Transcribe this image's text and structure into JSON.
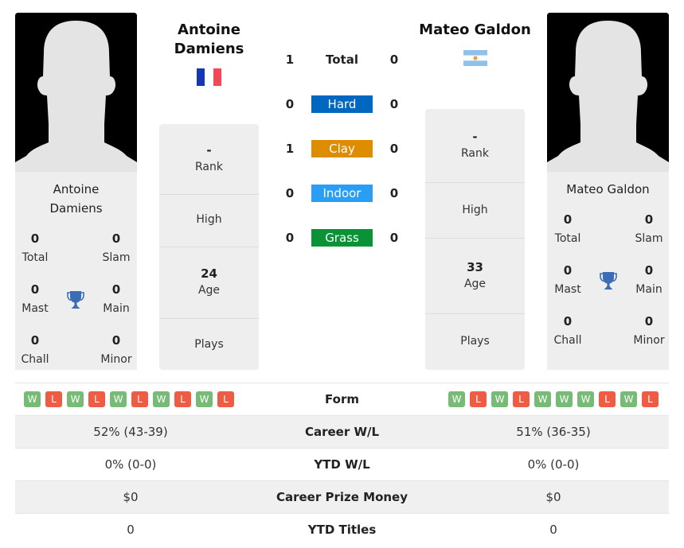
{
  "player_left": {
    "name": "Antoine Damiens",
    "card_name_line1": "Antoine",
    "card_name_line2": "Damiens",
    "flag": "france-flag",
    "titles": {
      "total": {
        "value": "0",
        "label": "Total"
      },
      "slam": {
        "value": "0",
        "label": "Slam"
      },
      "mast": {
        "value": "0",
        "label": "Mast"
      },
      "main": {
        "value": "0",
        "label": "Main"
      },
      "chall": {
        "value": "0",
        "label": "Chall"
      },
      "minor": {
        "value": "0",
        "label": "Minor"
      }
    },
    "info": {
      "rank": {
        "value": "-",
        "label": "Rank"
      },
      "high": {
        "value": "",
        "label": "High"
      },
      "age": {
        "value": "24",
        "label": "Age"
      },
      "plays": {
        "value": "",
        "label": "Plays"
      }
    },
    "form": [
      "W",
      "L",
      "W",
      "L",
      "W",
      "L",
      "W",
      "L",
      "W",
      "L"
    ]
  },
  "player_right": {
    "name": "Mateo Galdon",
    "card_name": "Mateo Galdon",
    "flag": "argentina-flag",
    "titles": {
      "total": {
        "value": "0",
        "label": "Total"
      },
      "slam": {
        "value": "0",
        "label": "Slam"
      },
      "mast": {
        "value": "0",
        "label": "Mast"
      },
      "main": {
        "value": "0",
        "label": "Main"
      },
      "chall": {
        "value": "0",
        "label": "Chall"
      },
      "minor": {
        "value": "0",
        "label": "Minor"
      }
    },
    "info": {
      "rank": {
        "value": "-",
        "label": "Rank"
      },
      "high": {
        "value": "",
        "label": "High"
      },
      "age": {
        "value": "33",
        "label": "Age"
      },
      "plays": {
        "value": "",
        "label": "Plays"
      }
    },
    "form": [
      "W",
      "L",
      "W",
      "L",
      "W",
      "W",
      "W",
      "L",
      "W",
      "L"
    ]
  },
  "h2h": [
    {
      "label": "Total",
      "left": "1",
      "right": "0",
      "color": ""
    },
    {
      "label": "Hard",
      "left": "0",
      "right": "0",
      "color": "#0068c0"
    },
    {
      "label": "Clay",
      "left": "1",
      "right": "0",
      "color": "#de8c00"
    },
    {
      "label": "Indoor",
      "left": "0",
      "right": "0",
      "color": "#2a9ef5"
    },
    {
      "label": "Grass",
      "left": "0",
      "right": "0",
      "color": "#0a9236"
    }
  ],
  "comparison": [
    {
      "label": "Form",
      "left": "",
      "right": ""
    },
    {
      "label": "Career W/L",
      "left": "52% (43-39)",
      "right": "51% (36-35)"
    },
    {
      "label": "YTD W/L",
      "left": "0% (0-0)",
      "right": "0% (0-0)"
    },
    {
      "label": "Career Prize Money",
      "left": "$0",
      "right": "$0"
    },
    {
      "label": "YTD Titles",
      "left": "0",
      "right": "0"
    }
  ],
  "colors": {
    "win": "#77bb77",
    "loss": "#ee5c44",
    "trophy": "#3a6db5"
  }
}
